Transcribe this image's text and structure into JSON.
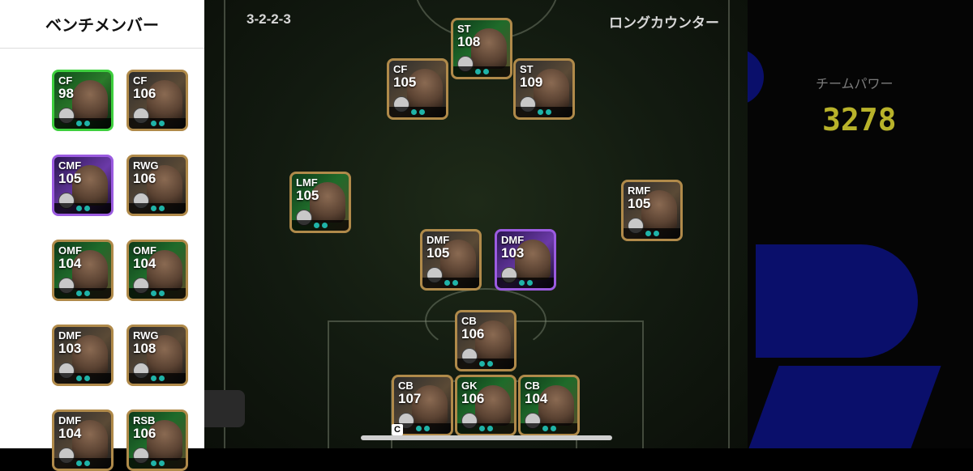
{
  "header": {
    "formation": "3-2-2-3",
    "tactic": "ロングカウンター"
  },
  "team_power": {
    "label": "チームパワー",
    "value": "3278"
  },
  "bench": {
    "title": "ベンチメンバー",
    "players": [
      {
        "pos": "CF",
        "ovr": "98",
        "style": "green"
      },
      {
        "pos": "CF",
        "ovr": "106",
        "style": "gold"
      },
      {
        "pos": "CMF",
        "ovr": "105",
        "style": "purple"
      },
      {
        "pos": "RWG",
        "ovr": "106",
        "style": "gold"
      },
      {
        "pos": "OMF",
        "ovr": "104",
        "style": "epic"
      },
      {
        "pos": "OMF",
        "ovr": "104",
        "style": "epic"
      },
      {
        "pos": "DMF",
        "ovr": "103",
        "style": "gold"
      },
      {
        "pos": "RWG",
        "ovr": "108",
        "style": "gold"
      },
      {
        "pos": "DMF",
        "ovr": "104",
        "style": "gold"
      },
      {
        "pos": "RSB",
        "ovr": "106",
        "style": "epic"
      }
    ]
  },
  "lineup": [
    {
      "pos": "ST",
      "ovr": "108",
      "style": "epic"
    },
    {
      "pos": "CF",
      "ovr": "105",
      "style": "gold"
    },
    {
      "pos": "ST",
      "ovr": "109",
      "style": "gold"
    },
    {
      "pos": "LMF",
      "ovr": "105",
      "style": "epic"
    },
    {
      "pos": "RMF",
      "ovr": "105",
      "style": "gold"
    },
    {
      "pos": "DMF",
      "ovr": "105",
      "style": "gold"
    },
    {
      "pos": "DMF",
      "ovr": "103",
      "style": "purple"
    },
    {
      "pos": "CB",
      "ovr": "106",
      "style": "gold"
    },
    {
      "pos": "CB",
      "ovr": "107",
      "style": "gold"
    },
    {
      "pos": "GK",
      "ovr": "106",
      "style": "epic"
    },
    {
      "pos": "CB",
      "ovr": "104",
      "style": "epic"
    }
  ],
  "captain_mark": "C"
}
